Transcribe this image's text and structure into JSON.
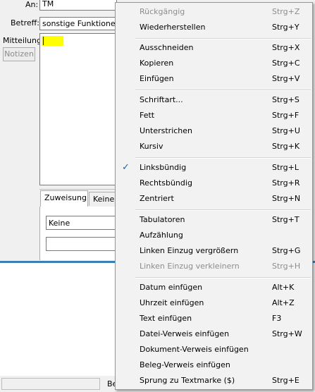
{
  "form": {
    "an_label": "An:",
    "an_value": "TM",
    "betreff_label": "Betreff:",
    "betreff_value": "sonstige Funktionen",
    "mitteilung_label": "Mitteilung:",
    "notizen_label": "Notizen",
    "tabs": [
      {
        "label": "Zuweisung"
      },
      {
        "label": "Keine F"
      }
    ],
    "zuweisung_value": "Keine",
    "status_text": "Be",
    "highlight_color": "#ffff00"
  },
  "context_menu": {
    "items": [
      {
        "label": "Rückgängig",
        "shortcut": "Strg+Z",
        "enabled": false
      },
      {
        "label": "Wiederherstellen",
        "shortcut": "Strg+Y",
        "enabled": true
      },
      {
        "label": "Ausschneiden",
        "shortcut": "Strg+X",
        "enabled": true
      },
      {
        "label": "Kopieren",
        "shortcut": "Strg+C",
        "enabled": true
      },
      {
        "label": "Einfügen",
        "shortcut": "Strg+V",
        "enabled": true
      },
      {
        "label": "Schriftart...",
        "shortcut": "Strg+S",
        "enabled": true
      },
      {
        "label": "Fett",
        "shortcut": "Strg+F",
        "enabled": true
      },
      {
        "label": "Unterstrichen",
        "shortcut": "Strg+U",
        "enabled": true
      },
      {
        "label": "Kursiv",
        "shortcut": "Strg+K",
        "enabled": true
      },
      {
        "label": "Linksbündig",
        "shortcut": "Strg+L",
        "enabled": true,
        "checked": true
      },
      {
        "label": "Rechtsbündig",
        "shortcut": "Strg+R",
        "enabled": true
      },
      {
        "label": "Zentriert",
        "shortcut": "Strg+N",
        "enabled": true
      },
      {
        "label": "Tabulatoren",
        "shortcut": "Strg+T",
        "enabled": true
      },
      {
        "label": "Aufzählung",
        "shortcut": "",
        "enabled": true
      },
      {
        "label": "Linken Einzug vergrößern",
        "shortcut": "Strg+G",
        "enabled": true
      },
      {
        "label": "Linken Einzug verkleinern",
        "shortcut": "Strg+H",
        "enabled": false
      },
      {
        "label": "Datum einfügen",
        "shortcut": "Alt+K",
        "enabled": true
      },
      {
        "label": "Uhrzeit einfügen",
        "shortcut": "Alt+Z",
        "enabled": true
      },
      {
        "label": "Text einfügen",
        "shortcut": "F3",
        "enabled": true
      },
      {
        "label": "Datei-Verweis einfügen",
        "shortcut": "Strg+W",
        "enabled": true
      },
      {
        "label": "Dokument-Verweis einfügen",
        "shortcut": "",
        "enabled": true
      },
      {
        "label": "Beleg-Verweis einfügen",
        "shortcut": "",
        "enabled": true
      },
      {
        "label": "Sprung zu Textmarke ($)",
        "shortcut": "Strg+E",
        "enabled": true
      }
    ],
    "check_icon": "checkmark-icon",
    "check_color": "#1e5fbf"
  }
}
